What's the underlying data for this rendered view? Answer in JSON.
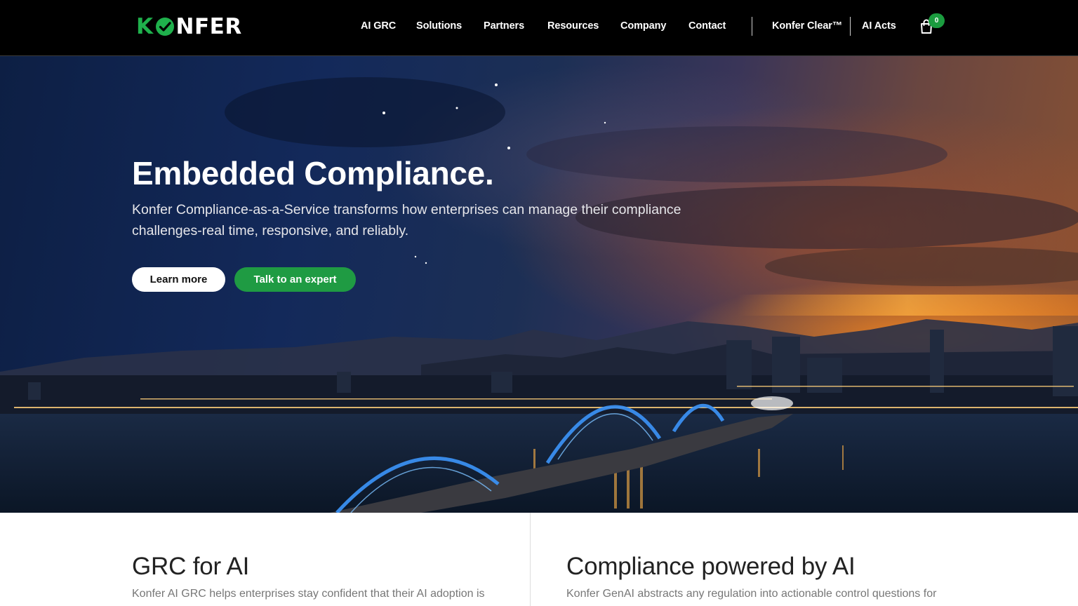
{
  "header": {
    "logo_text_first": "K",
    "logo_text_rest": "NFER",
    "nav": [
      {
        "label": "AI GRC"
      },
      {
        "label": "Solutions"
      },
      {
        "label": "Partners"
      },
      {
        "label": "Resources"
      },
      {
        "label": "Company"
      },
      {
        "label": "Contact"
      }
    ],
    "konfer_clear": "Konfer Clear™",
    "ai_acts": "AI Acts",
    "cart_count": "0",
    "cart_icon": "shopping-bag-icon",
    "colors": {
      "background": "#000000",
      "brand_green": "#1fb04c"
    }
  },
  "hero": {
    "title": "Embedded Compliance.",
    "description": "Konfer Compliance-as-a-Service transforms how enterprises can manage their compliance challenges-real time, responsive, and reliably.",
    "learn_more": "Learn more",
    "talk_expert": "Talk to an expert",
    "background_image": "night-city-skyline-with-illuminated-dragon-bridge-over-river-at-sunset",
    "colors": {
      "primary_button": "#1f9b43",
      "secondary_button": "#ffffff"
    }
  },
  "features": [
    {
      "title": "GRC for AI",
      "text": "Konfer AI GRC helps enterprises stay confident that their AI adoption is"
    },
    {
      "title": "Compliance powered by AI",
      "text": "Konfer GenAI abstracts any regulation into actionable control questions for"
    }
  ]
}
